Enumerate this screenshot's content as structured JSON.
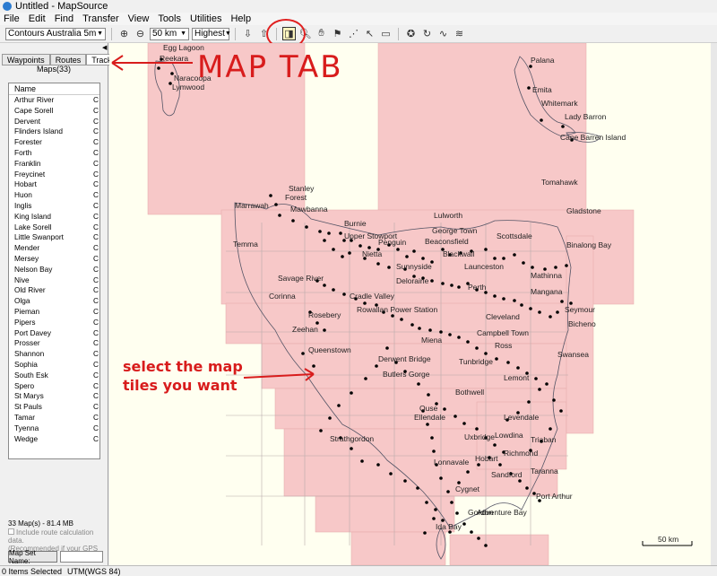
{
  "window": {
    "title": "Untitled - MapSource"
  },
  "menu": [
    "File",
    "Edit",
    "Find",
    "Transfer",
    "View",
    "Tools",
    "Utilities",
    "Help"
  ],
  "toolbar": {
    "product_select": "Contours Australia 5m",
    "zoom_select": "50 km",
    "detail_select": "Highest"
  },
  "sidebar": {
    "tabs": [
      "Waypoints",
      "Routes",
      "Tracks"
    ],
    "maps_count_label": "Maps(33)",
    "list_header": "Name",
    "list_col_suffix": "C",
    "maps": [
      "Arthur River",
      "Cape Sorell",
      "Dervent",
      "Flinders Island",
      "Forester",
      "Forth",
      "Franklin",
      "Freycinet",
      "Hobart",
      "Huon",
      "Inglis",
      "King Island",
      "Lake Sorell",
      "Little Swanport",
      "Mender",
      "Mersey",
      "Nelson Bay",
      "Nive",
      "Old River",
      "Olga",
      "Pieman",
      "Pipers",
      "Port Davey",
      "Prosser",
      "Shannon",
      "Sophia",
      "South Esk",
      "Spero",
      "St Marys",
      "St Pauls",
      "Tamar",
      "Tyenna",
      "Wedge"
    ],
    "stats": "33 Map(s) - 81.4 MB",
    "include_route_label": "Include route calculation data.",
    "include_route_note": "(Recommended if your GPS supp",
    "map_set_name_button": "Map Set Name:"
  },
  "map": {
    "scale_label": "50 km",
    "labels": [
      "Egg Lagoon",
      "Reekara",
      "Naracoopa",
      "Lymwood",
      "Palana",
      "Emita",
      "Whitemark",
      "Lady Barron",
      "Cape Barren Island",
      "Stanley",
      "Forest",
      "Mawbanna",
      "Marrawah",
      "Burnie",
      "Upper Stowport",
      "Penguin",
      "Nietta",
      "Lulworth",
      "George Town",
      "Beaconsfield",
      "Blackwall",
      "Tomahawk",
      "Gladstone",
      "Scottsdale",
      "Binalong Bay",
      "Temma",
      "Savage River",
      "Sunnyside",
      "Deloraine",
      "Launceston",
      "Mathinna",
      "Perth",
      "Mangana",
      "Corinna",
      "Cradle Valley",
      "Rowallan Power Station",
      "Cleveland",
      "Seymour",
      "Bicheno",
      "Rosebery",
      "Zeehan",
      "Campbell Town",
      "Queenstown",
      "Miena",
      "Ross",
      "Derwent Bridge",
      "Tunbridge",
      "Swansea",
      "Butlers Gorge",
      "Lemont",
      "Ouse",
      "Bothwell",
      "Levendale",
      "Ellendale",
      "Lowdina",
      "Triaban",
      "Strathgordon",
      "Richmond",
      "Uxbridge",
      "Hobart",
      "Sandford",
      "Lonnavale",
      "Taranna",
      "Cygnet",
      "Port Arthur",
      "Gordon",
      "Adventure Bay",
      "Ida Bay"
    ]
  },
  "annotations": {
    "map_tab": "MAP TAB",
    "select_tiles": "select the map\ntiles you want"
  },
  "status": {
    "items_selected": "0 Items Selected",
    "projection": "UTM(WGS 84)"
  }
}
